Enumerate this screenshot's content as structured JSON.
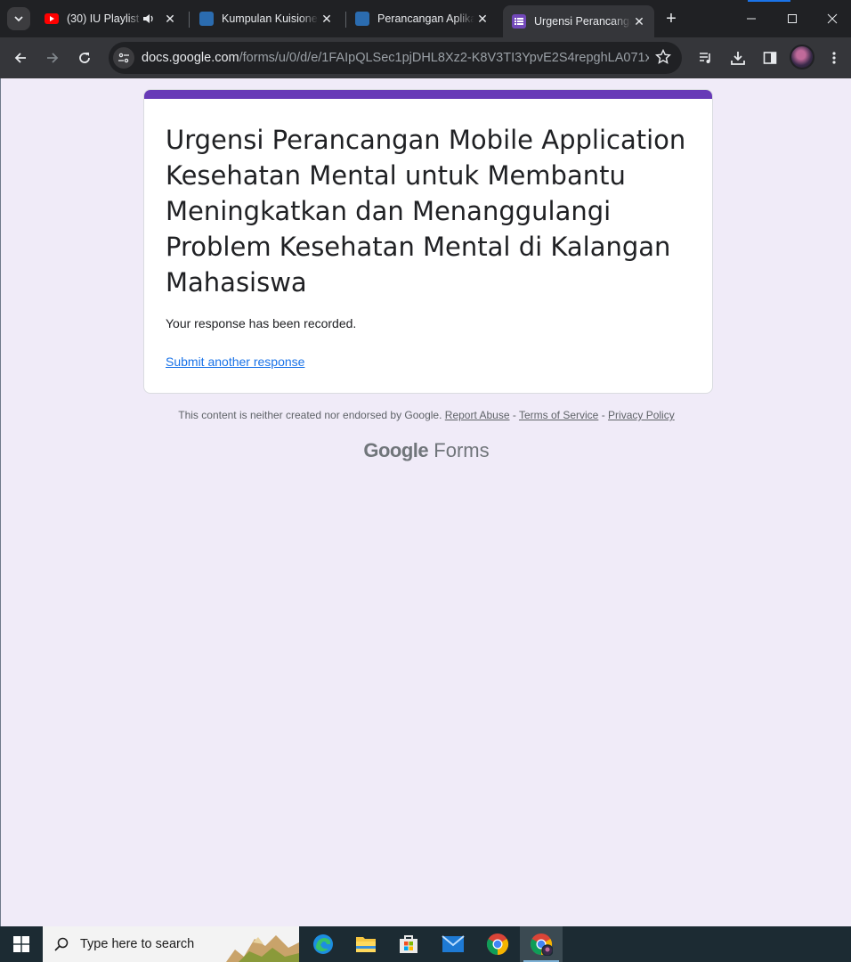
{
  "browser": {
    "tabs": [
      {
        "title": "(30) IU Playlist (",
        "favicon": "youtube-icon",
        "audio": true
      },
      {
        "title": "Kumpulan Kuisioner",
        "favicon": "site-icon"
      },
      {
        "title": "Perancangan Aplikasi",
        "favicon": "site-icon"
      },
      {
        "title": "Urgensi Perancangan",
        "favicon": "google-forms-icon",
        "active": true
      }
    ],
    "url_host": "docs.google.com",
    "url_path": "/forms/u/0/d/e/1FAIpQLSec1pjDHL8Xz2-K8V3TI3YpvE2S4repghLA071xq5..."
  },
  "form": {
    "title": "Urgensi Perancangan Mobile Application Kesehatan Mental untuk Membantu Meningkatkan dan Menanggulangi Problem Kesehatan Mental di Kalangan Mahasiswa",
    "confirmation": "Your response has been recorded.",
    "submit_another": "Submit another response",
    "accent_color": "#673ab7"
  },
  "footer": {
    "disclaimer": "This content is neither created nor endorsed by Google.",
    "report_abuse": "Report Abuse",
    "dash1": "-",
    "terms": "Terms of Service",
    "dash2": "-",
    "privacy": "Privacy Policy",
    "logo_google": "Google",
    "logo_forms": "Forms"
  },
  "taskbar": {
    "search_placeholder": "Type here to search",
    "apps": [
      "edge-icon",
      "file-explorer-icon",
      "store-icon",
      "mail-icon",
      "chrome-icon",
      "chrome-profile-icon"
    ]
  }
}
